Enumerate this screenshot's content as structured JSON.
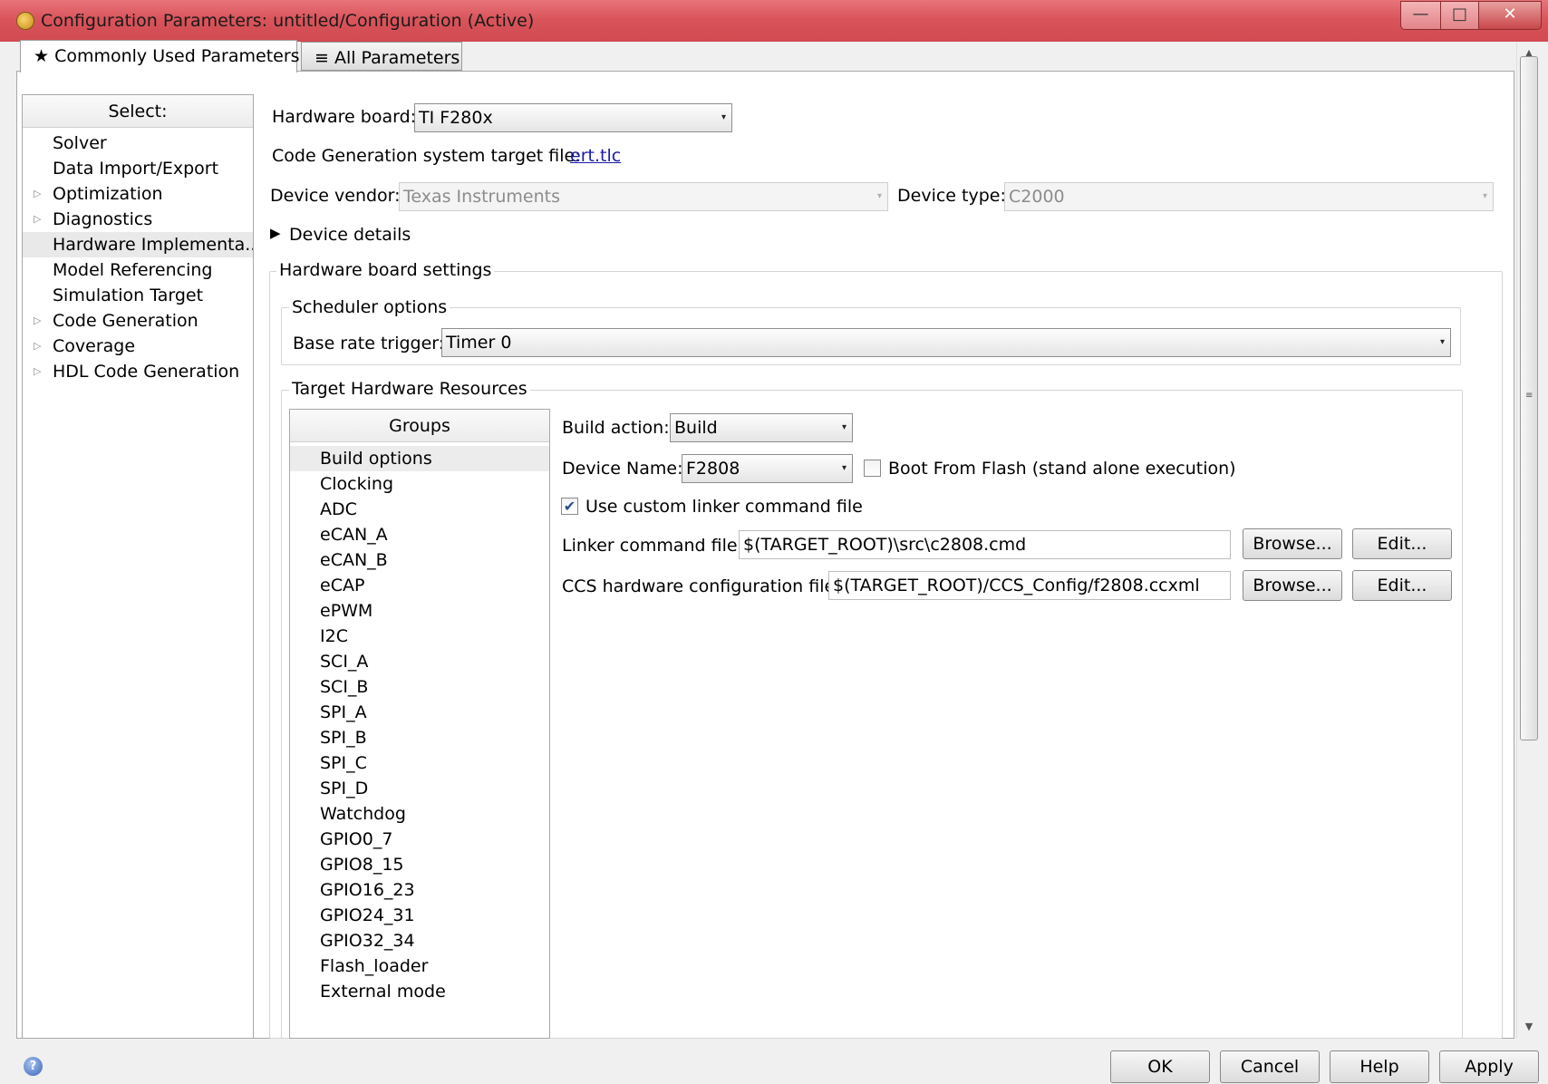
{
  "window": {
    "title": "Configuration Parameters: untitled/Configuration (Active)",
    "controls": {
      "minimize": "—",
      "maximize": "□",
      "close": "✕"
    }
  },
  "tabs": [
    {
      "label": "★ Commonly Used Parameters",
      "active": true
    },
    {
      "label": "≡ All Parameters",
      "active": false
    }
  ],
  "tree": {
    "header": "Select:",
    "items": [
      {
        "label": "Solver",
        "expandable": false,
        "selected": false
      },
      {
        "label": "Data Import/Export",
        "expandable": false,
        "selected": false
      },
      {
        "label": "Optimization",
        "expandable": true,
        "selected": false
      },
      {
        "label": "Diagnostics",
        "expandable": true,
        "selected": false
      },
      {
        "label": "Hardware Implementa...",
        "expandable": false,
        "selected": true
      },
      {
        "label": "Model Referencing",
        "expandable": false,
        "selected": false
      },
      {
        "label": "Simulation Target",
        "expandable": false,
        "selected": false
      },
      {
        "label": "Code Generation",
        "expandable": true,
        "selected": false
      },
      {
        "label": "Coverage",
        "expandable": true,
        "selected": false
      },
      {
        "label": "HDL Code Generation",
        "expandable": true,
        "selected": false
      }
    ],
    "expand_glyph": "▷"
  },
  "main": {
    "hardware_board_label": "Hardware board:",
    "hardware_board_value": "TI F280x",
    "codegen_label": "Code Generation system target file:",
    "codegen_link": "ert.tlc",
    "device_vendor_label": "Device vendor:",
    "device_vendor_value": "Texas Instruments",
    "device_type_label": "Device type:",
    "device_type_value": "C2000",
    "device_details_label": "Device details",
    "device_details_glyph": "▶",
    "board_settings_title": "Hardware board settings",
    "scheduler_title": "Scheduler options",
    "base_rate_label": "Base rate trigger:",
    "base_rate_value": "Timer 0",
    "target_resources_title": "Target Hardware Resources",
    "groups_header": "Groups",
    "groups": [
      "Build options",
      "Clocking",
      "ADC",
      "eCAN_A",
      "eCAN_B",
      "eCAP",
      "ePWM",
      "I2C",
      "SCI_A",
      "SCI_B",
      "SPI_A",
      "SPI_B",
      "SPI_C",
      "SPI_D",
      "Watchdog",
      "GPIO0_7",
      "GPIO8_15",
      "GPIO16_23",
      "GPIO24_31",
      "GPIO32_34",
      "Flash_loader",
      "External mode"
    ],
    "selected_group": "Build options",
    "build_action_label": "Build action:",
    "build_action_value": "Build",
    "device_name_label": "Device Name:",
    "device_name_value": "F2808",
    "boot_flash_label": "Boot From Flash (stand alone execution)",
    "boot_flash_checked": false,
    "custom_linker_label": "Use custom linker command file",
    "custom_linker_checked": true,
    "checkmark": "✔",
    "linker_file_label": "Linker command file:",
    "linker_file_value": "$(TARGET_ROOT)\\src\\c2808.cmd",
    "ccs_file_label": "CCS hardware configuration file:",
    "ccs_file_value": "$(TARGET_ROOT)/CCS_Config/f2808.ccxml",
    "browse_label": "Browse...",
    "edit_label": "Edit...",
    "dropdown_caret": "▾"
  },
  "footer": {
    "help_icon_glyph": "?",
    "ok_label": "OK",
    "cancel_label": "Cancel",
    "help_label": "Help",
    "apply_label": "Apply"
  },
  "scrollbar": {
    "up": "▲",
    "down": "▼",
    "grip": "≡"
  }
}
